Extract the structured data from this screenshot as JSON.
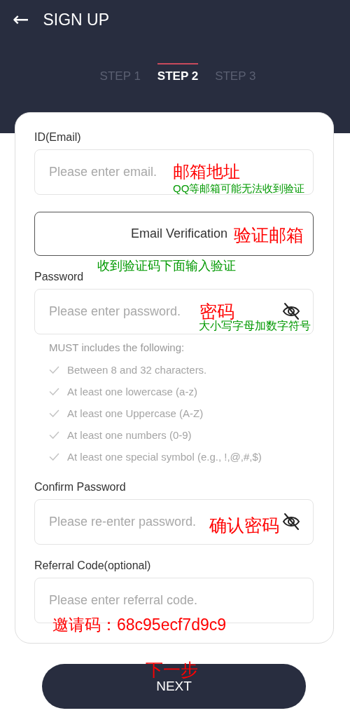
{
  "header": {
    "back_icon": "←",
    "title": "SIGN UP"
  },
  "steps": [
    {
      "label": "STEP 1",
      "selected": false
    },
    {
      "label": "STEP 2",
      "selected": true
    },
    {
      "label": "STEP 3",
      "selected": false
    }
  ],
  "form": [
    {
      "kind": "field",
      "label": "ID(Email)",
      "placeholder": "Please enter email.",
      "password_toggle": false
    },
    {
      "kind": "button",
      "label": "Email Verification"
    },
    {
      "kind": "field",
      "label": "Password",
      "placeholder": "Please enter password.",
      "password_toggle": true
    },
    {
      "kind": "rules",
      "title": "MUST includes the following:",
      "items": [
        "Between 8 and 32 characters.",
        "At least one lowercase (a-z)",
        "At least one Uppercase (A-Z)",
        "At least one numbers (0-9)",
        "At least one special symbol (e.g., !,@,#,$)"
      ]
    },
    {
      "kind": "field",
      "label": "Confirm Password",
      "placeholder": "Please re-enter password.",
      "password_toggle": true
    },
    {
      "kind": "field",
      "label": "Referral Code(optional)",
      "placeholder": "Please enter referral code.",
      "password_toggle": false
    }
  ],
  "next_button": "NEXT",
  "annotations": [
    {
      "text": "邮箱地址",
      "color": "#ff0000"
    },
    {
      "text": "QQ等邮箱可能无法收到验证",
      "color": "#009900"
    },
    {
      "text": "验证邮箱",
      "color": "#ff0000"
    },
    {
      "text": "收到验证码下面输入验证",
      "color": "#009900"
    },
    {
      "text": "密码",
      "color": "#ff0000"
    },
    {
      "text": "大小写字母加数字符号",
      "color": "#009900"
    },
    {
      "text": "确认密码",
      "color": "#ff0000"
    },
    {
      "text": "邀请码：68c95ecf7d9c9",
      "color": "#ff0000"
    },
    {
      "text": "下一步",
      "color": "#ff0000"
    }
  ]
}
